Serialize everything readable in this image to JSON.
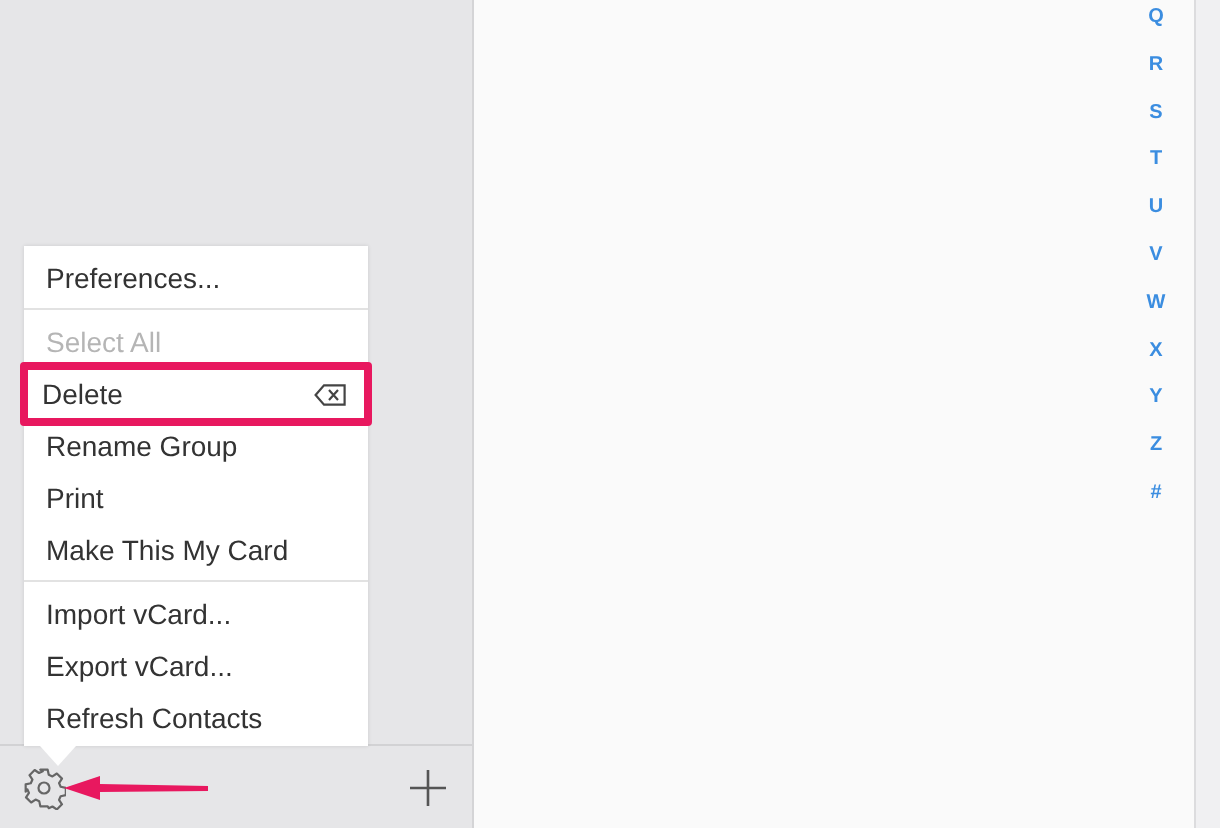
{
  "menu": {
    "items": [
      {
        "kind": "item",
        "label": "Preferences...",
        "disabled": false,
        "highlighted": false
      },
      {
        "kind": "separator"
      },
      {
        "kind": "item",
        "label": "Select All",
        "disabled": true,
        "highlighted": false
      },
      {
        "kind": "item",
        "label": "Delete",
        "disabled": false,
        "highlighted": true,
        "has_shortcut_icon": true
      },
      {
        "kind": "item",
        "label": "Rename Group",
        "disabled": false,
        "highlighted": false
      },
      {
        "kind": "item",
        "label": "Print",
        "disabled": false,
        "highlighted": false
      },
      {
        "kind": "item",
        "label": "Make This My Card",
        "disabled": false,
        "highlighted": false
      },
      {
        "kind": "separator"
      },
      {
        "kind": "item",
        "label": "Import vCard...",
        "disabled": false,
        "highlighted": false
      },
      {
        "kind": "item",
        "label": "Export vCard...",
        "disabled": false,
        "highlighted": false
      },
      {
        "kind": "item",
        "label": "Refresh Contacts",
        "disabled": false,
        "highlighted": false
      }
    ]
  },
  "index_letters": [
    "Q",
    "R",
    "S",
    "T",
    "U",
    "V",
    "W",
    "X",
    "Y",
    "Z",
    "#"
  ]
}
